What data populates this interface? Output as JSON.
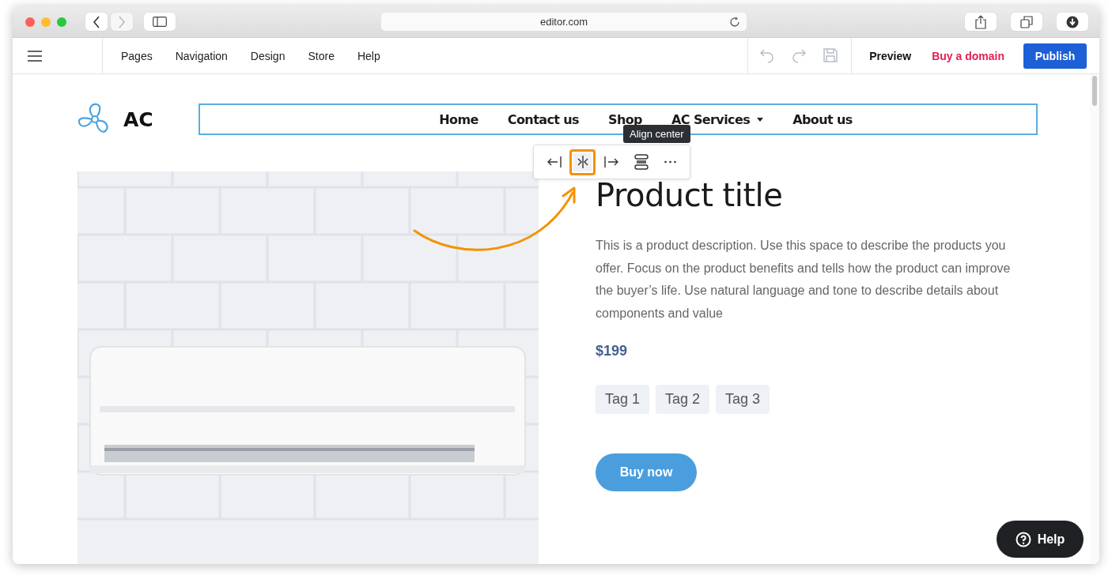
{
  "browser": {
    "address": "editor.com"
  },
  "editor_menu": [
    {
      "label": "Pages"
    },
    {
      "label": "Navigation"
    },
    {
      "label": "Design"
    },
    {
      "label": "Store"
    },
    {
      "label": "Help"
    }
  ],
  "history": [
    {
      "kind": "undo",
      "disabled": true
    },
    {
      "kind": "redo",
      "disabled": true
    },
    {
      "kind": "save",
      "disabled": true
    }
  ],
  "actions": [
    {
      "label": "Preview",
      "kind": "plain"
    },
    {
      "label": "Buy a domain",
      "kind": "link"
    },
    {
      "label": "Publish",
      "kind": "primary"
    }
  ],
  "site": {
    "logo": "AC",
    "nav": [
      {
        "label": "Home",
        "dropdown": false
      },
      {
        "label": "Contact us",
        "dropdown": false
      },
      {
        "label": "Shop",
        "dropdown": false
      },
      {
        "label": "AC Services",
        "dropdown": true
      },
      {
        "label": "About us",
        "dropdown": false
      }
    ]
  },
  "format_toolbar": {
    "tooltip": "Align center",
    "buttons": [
      {
        "kind": "align-left",
        "selected": false
      },
      {
        "kind": "align-center",
        "selected": true
      },
      {
        "kind": "align-right",
        "selected": false
      },
      {
        "kind": "layers",
        "selected": false
      },
      {
        "kind": "more",
        "selected": false
      }
    ]
  },
  "product": {
    "title": "Product title",
    "description": "This is a product description. Use this space to describe the products you offer. Focus on the product benefits and tells how the product can improve the buyer’s life. Use natural language and tone to describe details about components and value",
    "price": "$199",
    "tags": [
      "Tag 1",
      "Tag 2",
      "Tag 3"
    ],
    "button": "Buy now"
  },
  "help": {
    "label": "Help"
  }
}
